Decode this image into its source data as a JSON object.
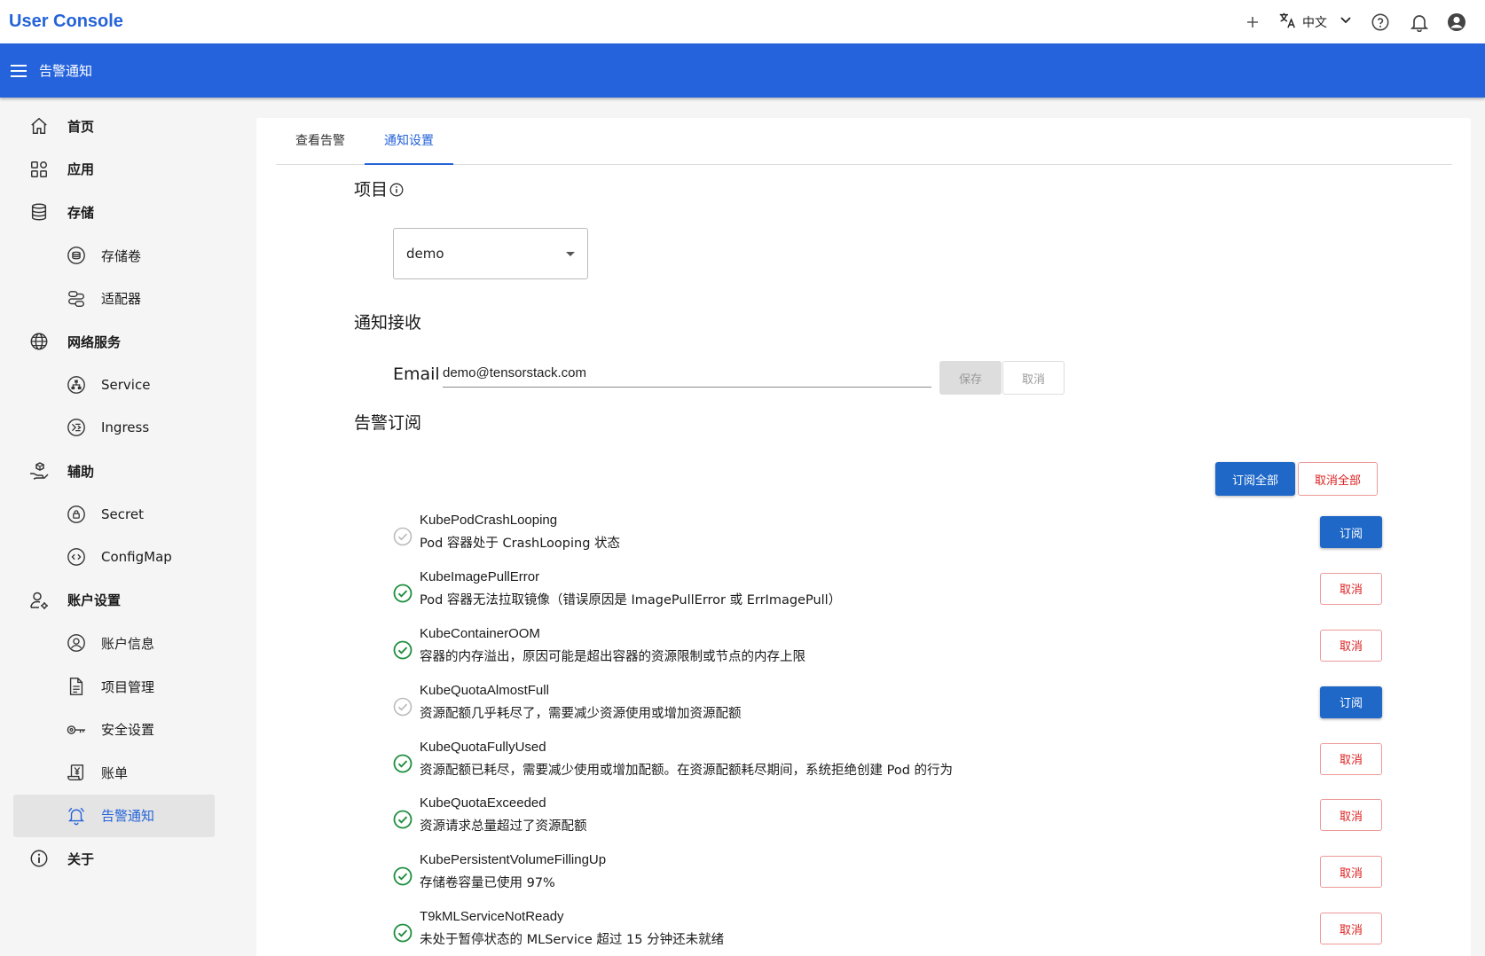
{
  "header": {
    "brand": "User Console",
    "language": "中文",
    "icons": [
      "add-icon",
      "translate-icon",
      "chevron-down-icon",
      "help-icon",
      "bell-icon",
      "account-icon"
    ]
  },
  "appbar": {
    "title": "告警通知"
  },
  "sidebar": {
    "items": [
      {
        "label": "首页",
        "icon": "home-icon",
        "level": "top"
      },
      {
        "label": "应用",
        "icon": "apps-icon",
        "level": "top"
      },
      {
        "label": "存储",
        "icon": "database-icon",
        "level": "top"
      },
      {
        "label": "存储卷",
        "icon": "volume-icon",
        "level": "sub"
      },
      {
        "label": "适配器",
        "icon": "adapter-icon",
        "level": "sub"
      },
      {
        "label": "网络服务",
        "icon": "globe-icon",
        "level": "top"
      },
      {
        "label": "Service",
        "icon": "service-icon",
        "level": "sub"
      },
      {
        "label": "Ingress",
        "icon": "ingress-icon",
        "level": "sub"
      },
      {
        "label": "辅助",
        "icon": "aux-icon",
        "level": "top"
      },
      {
        "label": "Secret",
        "icon": "secret-icon",
        "level": "sub"
      },
      {
        "label": "ConfigMap",
        "icon": "configmap-icon",
        "level": "sub"
      },
      {
        "label": "账户设置",
        "icon": "account-settings-icon",
        "level": "top"
      },
      {
        "label": "账户信息",
        "icon": "account-info-icon",
        "level": "sub"
      },
      {
        "label": "项目管理",
        "icon": "document-icon",
        "level": "sub"
      },
      {
        "label": "安全设置",
        "icon": "key-icon",
        "level": "sub"
      },
      {
        "label": "账单",
        "icon": "bill-icon",
        "level": "sub"
      },
      {
        "label": "告警通知",
        "icon": "bell-icon",
        "level": "sub",
        "active": true
      },
      {
        "label": "关于",
        "icon": "info-icon",
        "level": "top"
      }
    ]
  },
  "tabs": [
    {
      "label": "查看告警",
      "active": false
    },
    {
      "label": "通知设置",
      "active": true
    }
  ],
  "project": {
    "title": "项目",
    "value": "demo"
  },
  "notify": {
    "title": "通知接收",
    "email_label": "Email",
    "email_value": "demo@tensorstack.com",
    "save_label": "保存",
    "cancel_label": "取消"
  },
  "subscription": {
    "title": "告警订阅",
    "subscribe_all_label": "订阅全部",
    "unsubscribe_all_label": "取消全部",
    "alerts": [
      {
        "name": "KubePodCrashLooping",
        "desc": "Pod 容器处于 CrashLooping 状态",
        "subscribed": false,
        "action": "订阅"
      },
      {
        "name": "KubeImagePullError",
        "desc": "Pod 容器无法拉取镜像（错误原因是 ImagePullError 或 ErrImagePull）",
        "subscribed": true,
        "action": "取消"
      },
      {
        "name": "KubeContainerOOM",
        "desc": "容器的内存溢出，原因可能是超出容器的资源限制或节点的内存上限",
        "subscribed": true,
        "action": "取消"
      },
      {
        "name": "KubeQuotaAlmostFull",
        "desc": "资源配额几乎耗尽了，需要减少资源使用或增加资源配额",
        "subscribed": false,
        "action": "订阅"
      },
      {
        "name": "KubeQuotaFullyUsed",
        "desc": "资源配额已耗尽，需要减少使用或增加配额。在资源配额耗尽期间，系统拒绝创建 Pod 的行为",
        "subscribed": true,
        "action": "取消"
      },
      {
        "name": "KubeQuotaExceeded",
        "desc": "资源请求总量超过了资源配额",
        "subscribed": true,
        "action": "取消"
      },
      {
        "name": "KubePersistentVolumeFillingUp",
        "desc": "存储卷容量已使用 97%",
        "subscribed": true,
        "action": "取消"
      },
      {
        "name": "T9kMLServiceNotReady",
        "desc": "未处于暂停状态的 MLService 超过 15 分钟还未就绪",
        "subscribed": true,
        "action": "取消"
      }
    ]
  },
  "colors": {
    "primary": "#2563dd",
    "success": "#1e8e3e",
    "danger": "#dd2222",
    "muted": "#999999"
  }
}
